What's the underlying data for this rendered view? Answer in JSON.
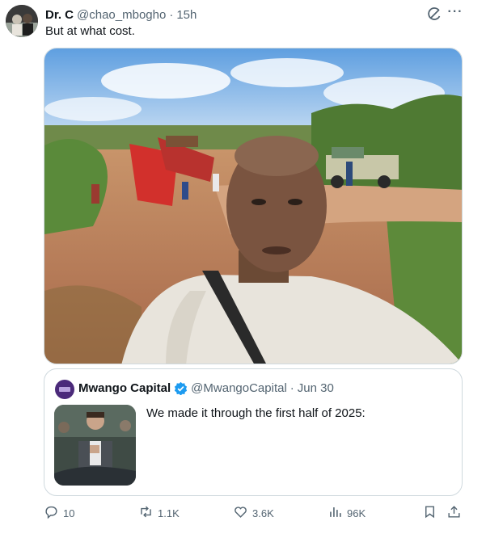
{
  "tweet": {
    "author_name": "Dr. C",
    "author_handle": "@chao_mbogho",
    "separator": "·",
    "time": "15h",
    "text": "But at what cost.",
    "more_label": "···"
  },
  "quote": {
    "author_name": "Mwango Capital",
    "author_handle": "@MwangoCapital",
    "separator": "·",
    "date": "Jun 30",
    "text": "We made it through the first half of 2025:"
  },
  "actions": {
    "replies": "10",
    "reposts": "1.1K",
    "likes": "3.6K",
    "views": "96K"
  },
  "colors": {
    "text_primary": "#0f1419",
    "text_secondary": "#536471",
    "border": "#cfd9de",
    "verified": "#1d9bf0"
  },
  "icons": [
    "grok-icon",
    "more-icon",
    "verified-icon",
    "reply-icon",
    "repost-icon",
    "like-icon",
    "views-icon",
    "bookmark-icon",
    "share-icon"
  ]
}
